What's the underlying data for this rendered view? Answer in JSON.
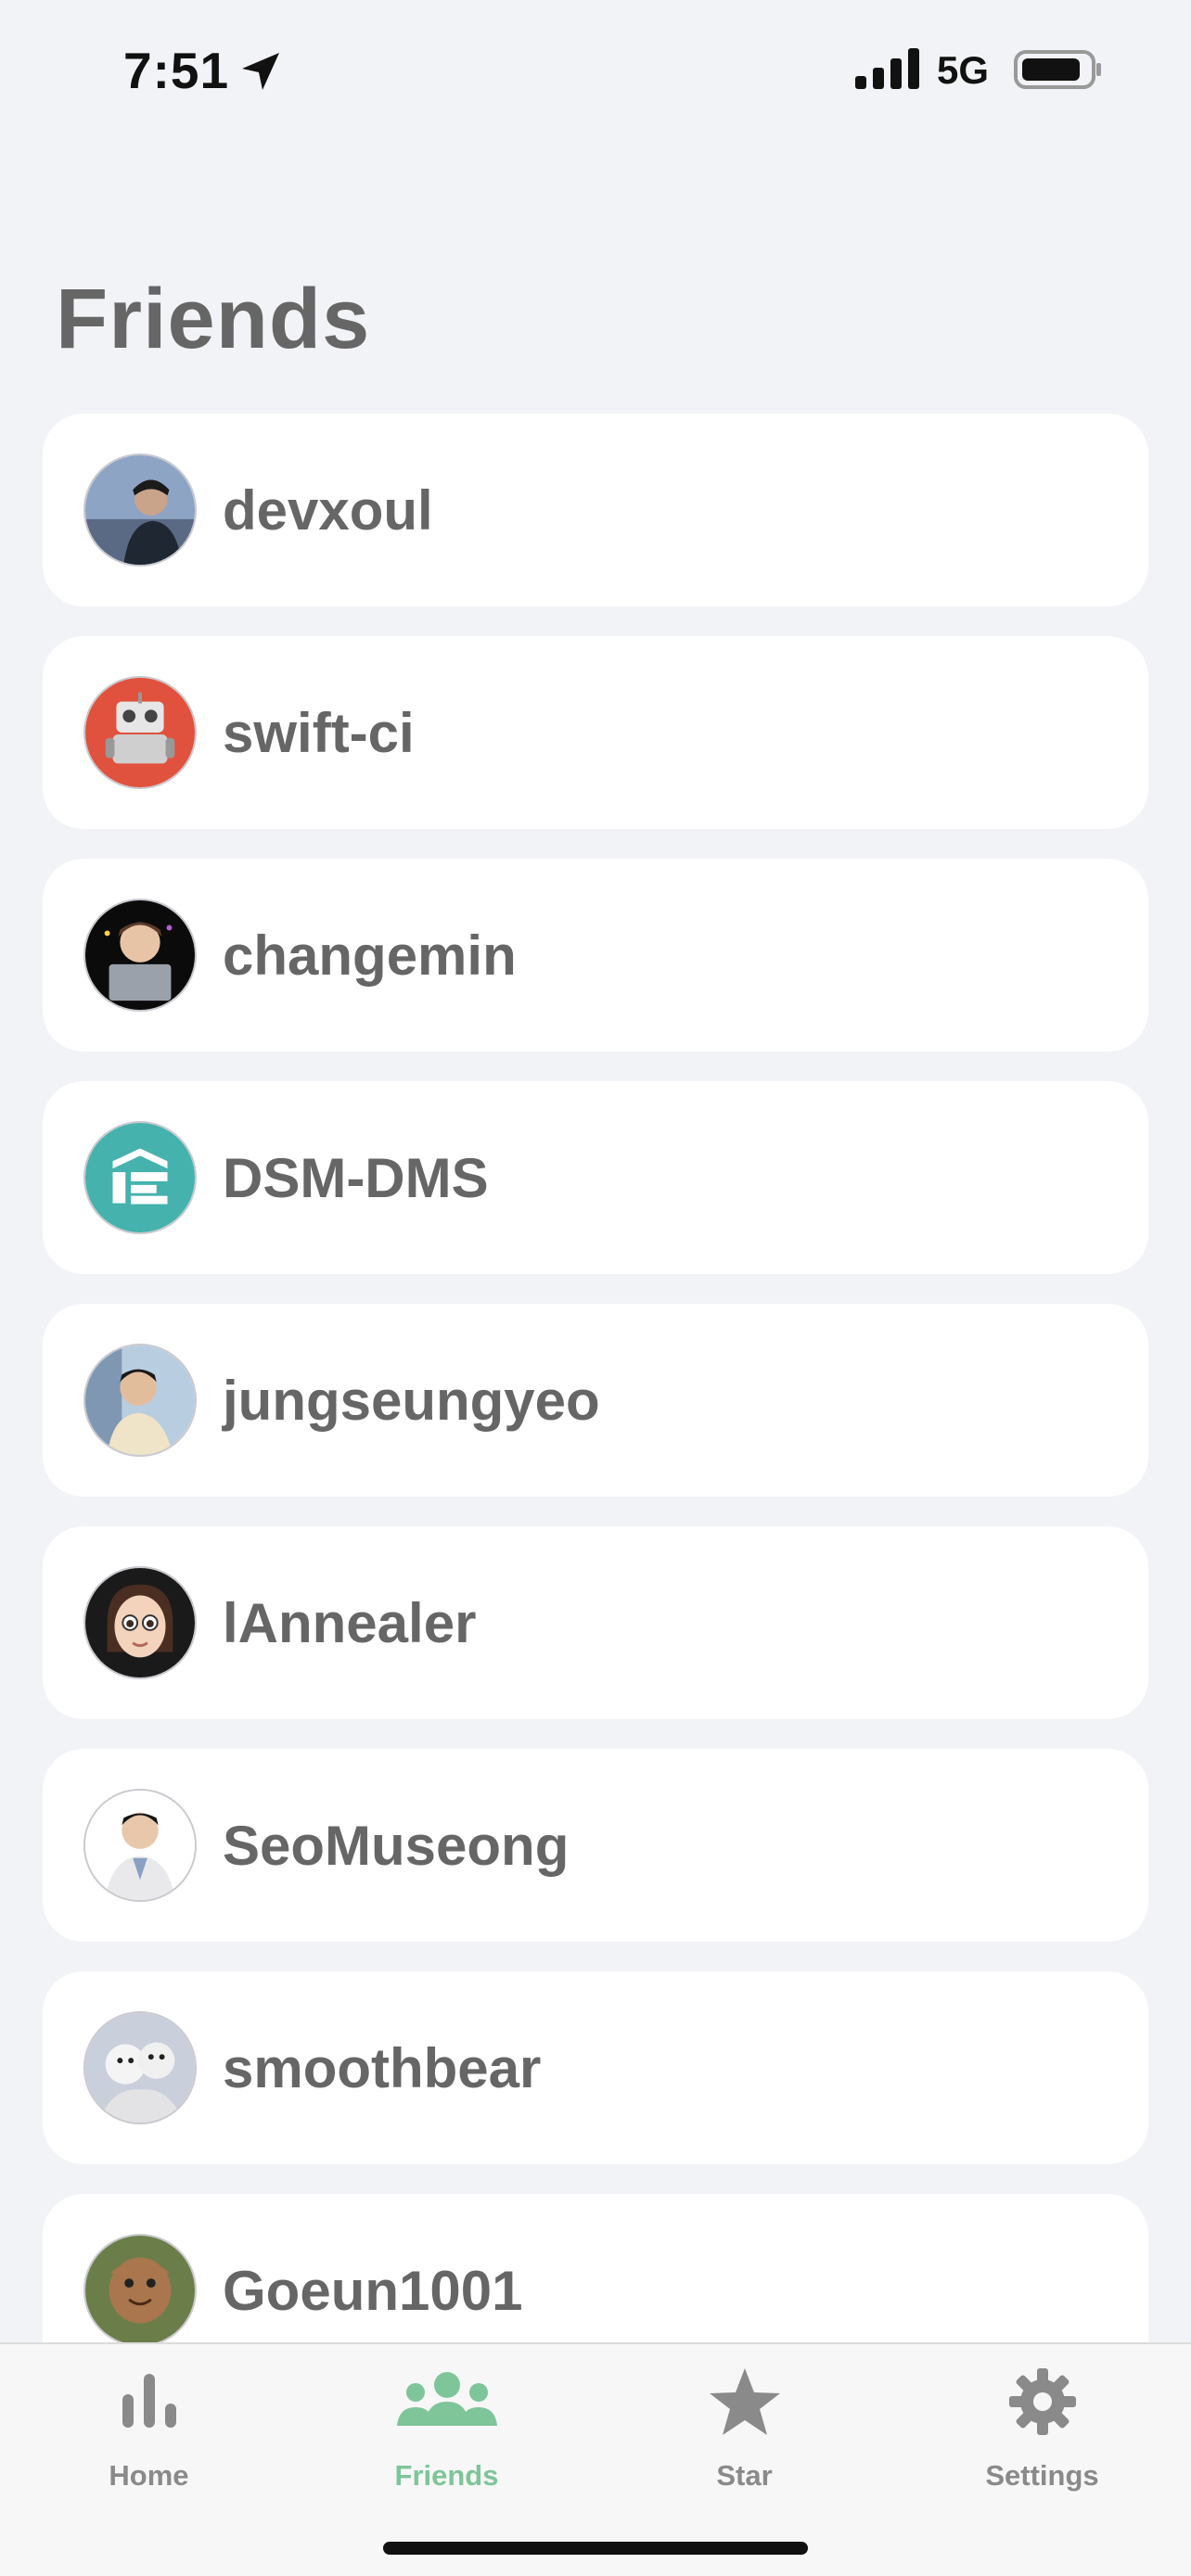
{
  "status_bar": {
    "time": "7:51",
    "network": "5G",
    "icons": [
      "location-arrow-icon",
      "signal-icon",
      "battery-icon"
    ]
  },
  "title": "Friends",
  "friends": [
    {
      "name": "devxoul",
      "avatar": "photo-avatar"
    },
    {
      "name": "swift-ci",
      "avatar": "robot-avatar"
    },
    {
      "name": "changemin",
      "avatar": "character-avatar"
    },
    {
      "name": "DSM-DMS",
      "avatar": "logo-avatar"
    },
    {
      "name": "jungseungyeo",
      "avatar": "photo-avatar"
    },
    {
      "name": "lAnnealer",
      "avatar": "memoji-avatar"
    },
    {
      "name": "SeoMuseong",
      "avatar": "photo-avatar"
    },
    {
      "name": "smoothbear",
      "avatar": "bear-avatar"
    },
    {
      "name": "Goeun1001",
      "avatar": "character-avatar"
    }
  ],
  "tabs": [
    {
      "label": "Home",
      "icon": "bar-chart-icon",
      "active": false
    },
    {
      "label": "Friends",
      "icon": "people-icon",
      "active": true
    },
    {
      "label": "Star",
      "icon": "star-icon",
      "active": false
    },
    {
      "label": "Settings",
      "icon": "gear-icon",
      "active": false
    }
  ],
  "colors": {
    "background": "#f2f3f7",
    "card": "#ffffff",
    "text": "#666666",
    "accent": "#7fc59a",
    "tab_inactive": "#8a8a8a"
  }
}
